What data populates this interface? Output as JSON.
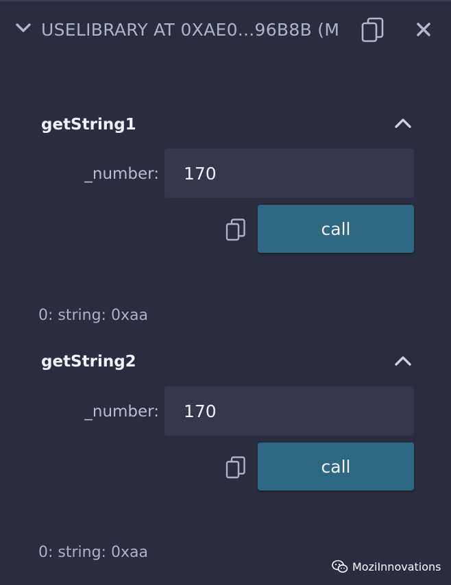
{
  "header": {
    "title": "USELIBRARY AT 0XAE0...96B8B (M",
    "collapse_icon": "chevron-down-icon",
    "copy_icon": "copy-icon",
    "close_icon": "close-icon"
  },
  "functions": [
    {
      "name": "getString1",
      "toggle_icon": "chevron-up-icon",
      "param_label": "_number:",
      "param_value": "170",
      "copy_icon": "copy-icon",
      "button_label": "call",
      "result": "0: string: 0xaa"
    },
    {
      "name": "getString2",
      "toggle_icon": "chevron-up-icon",
      "param_label": "_number:",
      "param_value": "170",
      "copy_icon": "copy-icon",
      "button_label": "call",
      "result": "0: string: 0xaa"
    }
  ],
  "watermark": {
    "icon": "wechat-icon",
    "text": "MoziInnovations"
  },
  "colors": {
    "background": "#2a2c3f",
    "input_background": "#35374d",
    "call_button": "#2e6882",
    "text_primary": "#f1f2f7",
    "text_secondary": "#aeb3c8"
  }
}
